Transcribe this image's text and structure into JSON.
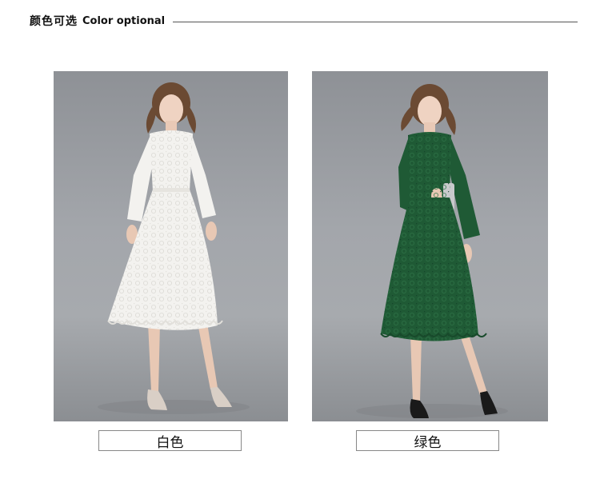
{
  "header": {
    "title_cn": "颜色可选",
    "title_en": "Color optional"
  },
  "options": [
    {
      "label": "白色",
      "dress_color": "#f3f2ef",
      "shadow_color": "#d6d4cf"
    },
    {
      "label": "绿色",
      "dress_color": "#1f5a35",
      "shadow_color": "#153f25"
    }
  ]
}
